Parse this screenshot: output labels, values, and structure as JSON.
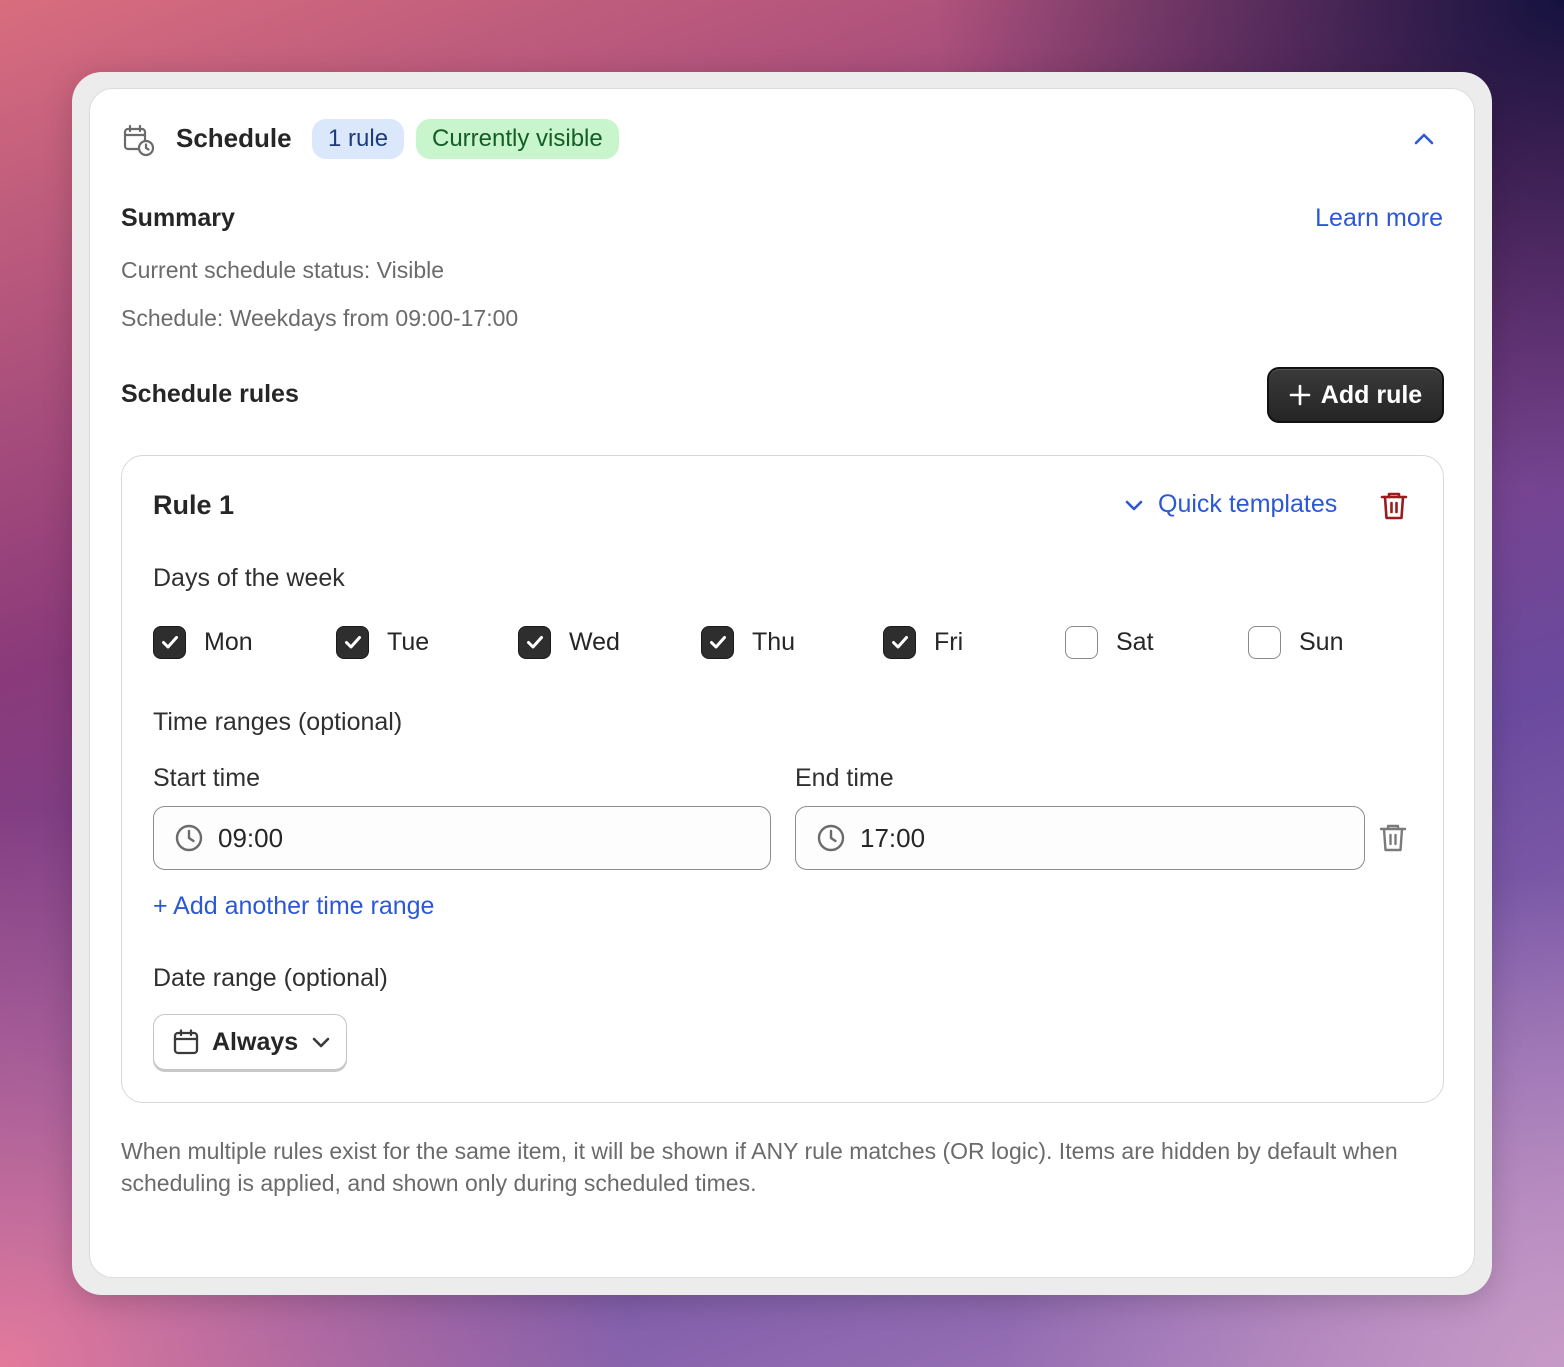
{
  "header": {
    "title": "Schedule",
    "rule_count_badge": "1 rule",
    "status_badge": "Currently visible"
  },
  "summary": {
    "heading": "Summary",
    "learn_more": "Learn more",
    "status_line": "Current schedule status: Visible",
    "schedule_line": "Schedule: Weekdays from 09:00-17:00"
  },
  "rules_section": {
    "heading": "Schedule rules",
    "add_rule": "Add rule"
  },
  "rule": {
    "title": "Rule 1",
    "quick_templates": "Quick templates",
    "days_label": "Days of the week",
    "days": [
      {
        "label": "Mon",
        "checked": true
      },
      {
        "label": "Tue",
        "checked": true
      },
      {
        "label": "Wed",
        "checked": true
      },
      {
        "label": "Thu",
        "checked": true
      },
      {
        "label": "Fri",
        "checked": true
      },
      {
        "label": "Sat",
        "checked": false
      },
      {
        "label": "Sun",
        "checked": false
      }
    ],
    "time_ranges_label": "Time ranges (optional)",
    "start_label": "Start time",
    "start_value": "09:00",
    "end_label": "End time",
    "end_value": "17:00",
    "add_time_range": "+ Add another time range",
    "date_range_label": "Date range (optional)",
    "date_range_value": "Always"
  },
  "footnote": "When multiple rules exist for the same item, it will be shown if ANY rule matches (OR logic). Items are hidden by default when scheduling is applied, and shown only during scheduled times.",
  "colors": {
    "link": "#2c58d6",
    "delete_red": "#9b1c1c",
    "badge_blue_bg": "#dbe7fb",
    "badge_green_bg": "#c9f5cd"
  }
}
